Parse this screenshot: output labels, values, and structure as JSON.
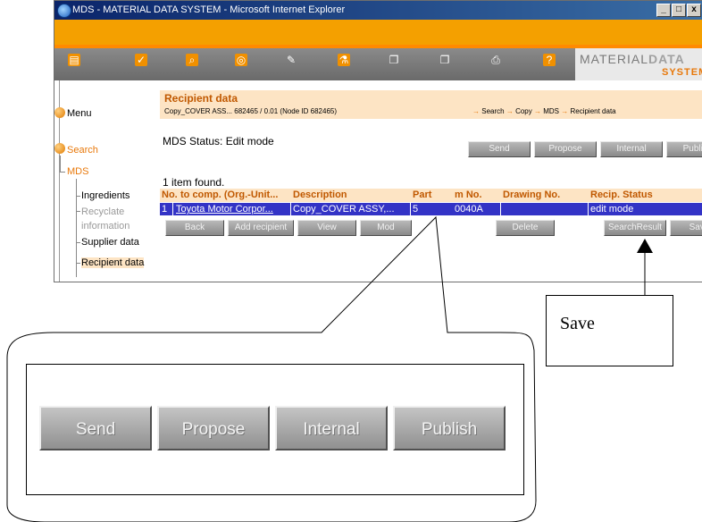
{
  "window": {
    "title": "MDS - MATERIAL DATA SYSTEM - Microsoft Internet Explorer",
    "controls": [
      "_",
      "□",
      "x"
    ]
  },
  "logo": {
    "material": "MATERIAL",
    "data": "DATA",
    "system": "SYSTEM"
  },
  "nav_icons": [
    "document-icon",
    "check-icon",
    "search-icon",
    "ring-icon",
    "pen-icon",
    "flask-icon",
    "copy-icon",
    "copy-icon",
    "printer-icon",
    "help-icon"
  ],
  "left_menu": {
    "menu": "Menu",
    "search": "Search",
    "mds": "MDS",
    "items": [
      "Ingredients",
      "Recyclate",
      "information",
      "Supplier data",
      "Recipient data"
    ]
  },
  "page": {
    "title": "Recipient data",
    "subtitle": "Copy_COVER ASS... 682465 / 0.01 (Node ID 682465)",
    "breadcrumbs": [
      "Search",
      "Copy",
      "MDS",
      "Recipient data"
    ],
    "status": "MDS Status: Edit mode",
    "action_buttons": [
      "Send",
      "Propose",
      "Internal",
      "Publish"
    ],
    "found": "1 item found.",
    "table": {
      "headers": [
        "No.",
        "to comp. (Org.-Unit...",
        "Description",
        "Part",
        "m No.",
        "Drawing No.",
        "Recip. Status"
      ],
      "row": [
        "1",
        "Toyota Motor Corpor...",
        "Copy_COVER ASSY,...",
        "5",
        "0040A",
        "",
        "edit mode"
      ]
    },
    "row_buttons": [
      "Back",
      "Add recipient",
      "View",
      "Mod",
      "Delete",
      "SearchResult",
      "Save"
    ]
  },
  "callout": {
    "label": "Save",
    "zoom_buttons": [
      "Send",
      "Propose",
      "Internal",
      "Publish"
    ]
  }
}
